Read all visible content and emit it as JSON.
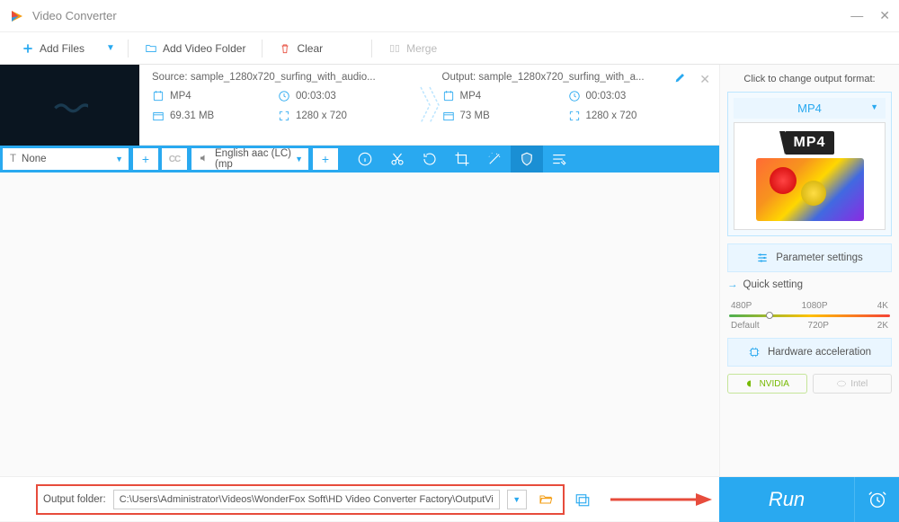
{
  "window": {
    "title": "Video Converter"
  },
  "toolbar": {
    "add_files": "Add Files",
    "add_folder": "Add Video Folder",
    "clear": "Clear",
    "merge": "Merge"
  },
  "item": {
    "source_prefix": "Source: ",
    "source_file": "sample_1280x720_surfing_with_audio...",
    "output_prefix": "Output: ",
    "output_file": "sample_1280x720_surfing_with_a...",
    "src": {
      "format": "MP4",
      "duration": "00:03:03",
      "size": "69.31 MB",
      "resolution": "1280 x 720"
    },
    "out": {
      "format": "MP4",
      "duration": "00:03:03",
      "size": "73 MB",
      "resolution": "1280 x 720"
    }
  },
  "optbar": {
    "subtitle": "None",
    "cc": "CC",
    "audio": "English aac (LC) (mp"
  },
  "right": {
    "hint": "Click to change output format:",
    "format": "MP4",
    "badge": "MP4",
    "param": "Parameter settings",
    "quick": "Quick setting",
    "ticks_top": [
      "480P",
      "1080P",
      "4K"
    ],
    "ticks_bot": [
      "Default",
      "720P",
      "2K"
    ],
    "hw": "Hardware acceleration",
    "nvidia": "NVIDIA",
    "intel": "Intel"
  },
  "bottom": {
    "label": "Output folder:",
    "path": "C:\\Users\\Administrator\\Videos\\WonderFox Soft\\HD Video Converter Factory\\OutputVideo",
    "run": "Run"
  }
}
